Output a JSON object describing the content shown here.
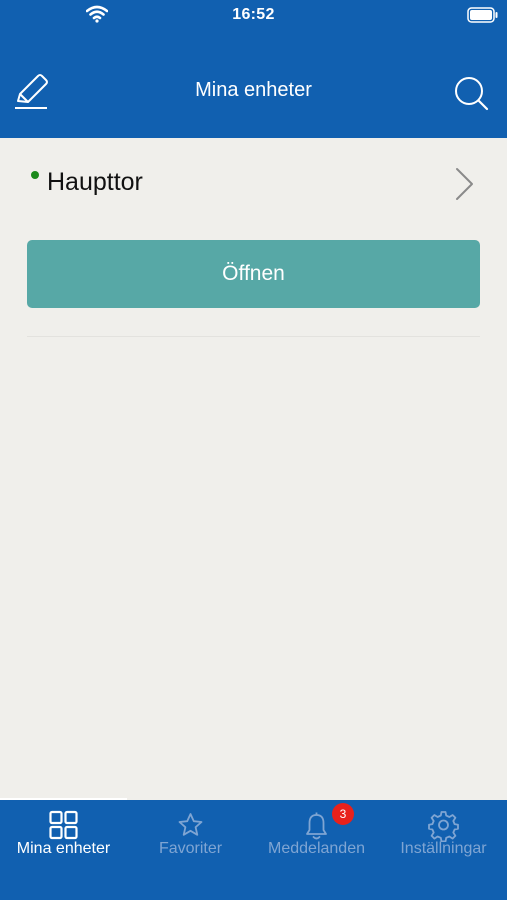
{
  "status_bar": {
    "time": "16:52",
    "wifi_icon": "wifi-icon",
    "battery_icon": "battery-icon"
  },
  "nav": {
    "title": "Mina enheter",
    "left_icon": "edit-icon",
    "right_icon": "search-icon"
  },
  "device": {
    "name": "Haupttor",
    "status_color": "#1b8a1b",
    "open_label": "Öffnen",
    "button_color": "#57a8a6"
  },
  "tabs": [
    {
      "label": "Mina enheter",
      "icon": "grid-icon",
      "active": true
    },
    {
      "label": "Favoriter",
      "icon": "star-icon",
      "active": false
    },
    {
      "label": "Meddelanden",
      "icon": "bell-icon",
      "active": false,
      "badge": "3"
    },
    {
      "label": "Inställningar",
      "icon": "gear-icon",
      "active": false
    }
  ],
  "colors": {
    "primary": "#1160b0",
    "background": "#f0efeb",
    "badge": "#e8211c"
  }
}
